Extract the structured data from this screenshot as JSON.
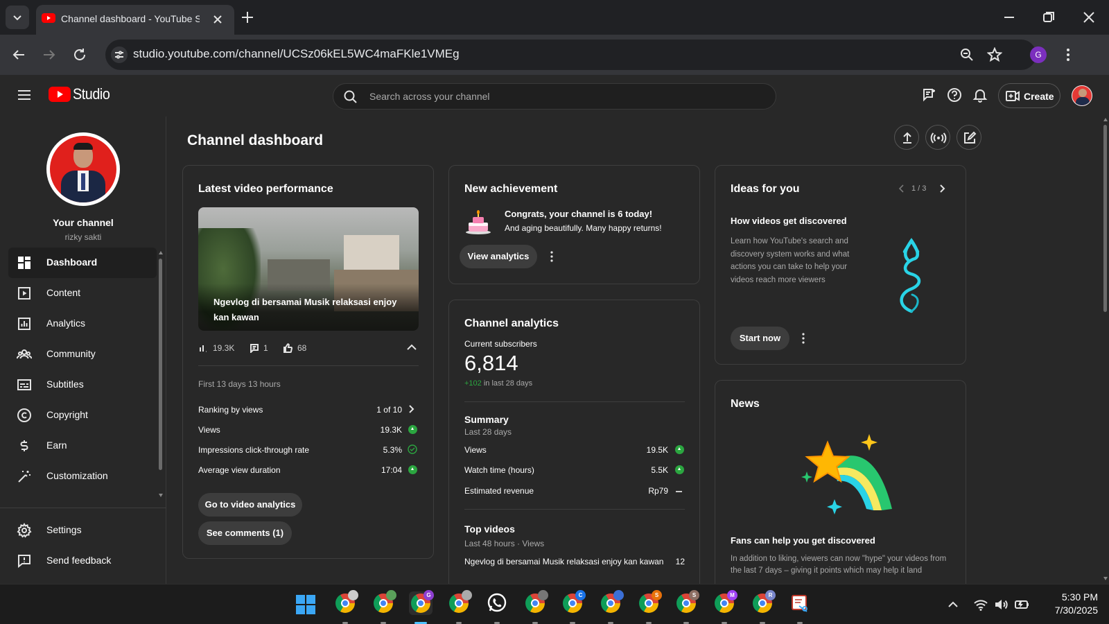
{
  "browser": {
    "tab_title": "Channel dashboard - YouTube S",
    "url": "studio.youtube.com/channel/UCSz06kEL5WC4maFKle1VMEg",
    "profile_initial": "G"
  },
  "header": {
    "logo_text": "Studio",
    "search_placeholder": "Search across your channel",
    "create_label": "Create"
  },
  "sidebar": {
    "channel_label": "Your channel",
    "channel_name": "rizky sakti",
    "items": [
      {
        "label": "Dashboard",
        "icon": "dashboard-icon",
        "active": true
      },
      {
        "label": "Content",
        "icon": "content-icon"
      },
      {
        "label": "Analytics",
        "icon": "analytics-icon"
      },
      {
        "label": "Community",
        "icon": "community-icon"
      },
      {
        "label": "Subtitles",
        "icon": "subtitles-icon"
      },
      {
        "label": "Copyright",
        "icon": "copyright-icon"
      },
      {
        "label": "Earn",
        "icon": "earn-icon"
      },
      {
        "label": "Customization",
        "icon": "customization-icon"
      }
    ],
    "settings_label": "Settings",
    "feedback_label": "Send feedback"
  },
  "page": {
    "title": "Channel dashboard"
  },
  "latest_video": {
    "title": "Latest video performance",
    "video_title": "Ngevlog di bersamai Musik relaksasi enjoy kan kawan",
    "views": "19.3K",
    "comments": "1",
    "likes": "68",
    "period": "First 13 days 13 hours",
    "rows": [
      {
        "label": "Ranking by views",
        "value": "1 of 10"
      },
      {
        "label": "Views",
        "value": "19.3K"
      },
      {
        "label": "Impressions click-through rate",
        "value": "5.3%"
      },
      {
        "label": "Average view duration",
        "value": "17:04"
      }
    ],
    "go_analytics_label": "Go to video analytics",
    "see_comments_label": "See comments (1)"
  },
  "achievement": {
    "title": "New achievement",
    "headline": "Congrats, your channel is 6 today!",
    "subline": "And aging beautifully. Many happy returns!",
    "button_label": "View analytics"
  },
  "channel_analytics": {
    "title": "Channel analytics",
    "subs_label": "Current subscribers",
    "subs_value": "6,814",
    "subs_delta": "+102",
    "subs_delta_suffix": " in last 28 days",
    "summary_title": "Summary",
    "summary_period": "Last 28 days",
    "summary_rows": [
      {
        "label": "Views",
        "value": "19.5K"
      },
      {
        "label": "Watch time (hours)",
        "value": "5.5K"
      },
      {
        "label": "Estimated revenue",
        "value": "Rp79"
      }
    ],
    "top_title": "Top videos",
    "top_period": "Last 48 hours · Views",
    "top_video_title": "Ngevlog di bersamai Musik relaksasi enjoy kan kawan",
    "top_video_views": "12"
  },
  "ideas": {
    "title": "Ideas for you",
    "pager": "1 / 3",
    "heading": "How videos get discovered",
    "body": "Learn how YouTube's search and discovery system works and what actions you can take to help your videos reach more viewers",
    "button_label": "Start now"
  },
  "news": {
    "title": "News",
    "heading": "Fans can help you get discovered",
    "body": "In addition to liking, viewers can now \"hype\" your videos from the last 7 days – giving it points which may help it land"
  },
  "taskbar": {
    "time": "5:30 PM",
    "date": "7/30/2025",
    "apps": [
      {
        "name": "chrome-profile-1",
        "badge": "",
        "badge_color": "#cccccc"
      },
      {
        "name": "chrome-profile-2",
        "badge": "",
        "badge_color": "#5aa05a"
      },
      {
        "name": "chrome-profile-g",
        "badge": "G",
        "badge_color": "#8e3fd1"
      },
      {
        "name": "chrome-profile-4",
        "badge": "",
        "badge_color": "#aaaaaa"
      },
      {
        "name": "whatsapp",
        "badge": "",
        "badge_color": ""
      },
      {
        "name": "chrome-profile-5",
        "badge": "",
        "badge_color": "#777777"
      },
      {
        "name": "chrome-profile-c",
        "badge": "C",
        "badge_color": "#1a73e8"
      },
      {
        "name": "chrome-profile-7",
        "badge": "",
        "badge_color": "#3b6fd6"
      },
      {
        "name": "chrome-profile-s1",
        "badge": "S",
        "badge_color": "#e8710a"
      },
      {
        "name": "chrome-profile-s2",
        "badge": "S",
        "badge_color": "#8d6e63"
      },
      {
        "name": "chrome-profile-m",
        "badge": "M",
        "badge_color": "#a142f4"
      },
      {
        "name": "chrome-profile-r",
        "badge": "R",
        "badge_color": "#7986cb"
      },
      {
        "name": "snipping-tool",
        "badge": "",
        "badge_color": ""
      }
    ]
  },
  "colors": {
    "accent_green": "#2ba640",
    "youtube_red": "#ff0000",
    "background": "#282828"
  }
}
